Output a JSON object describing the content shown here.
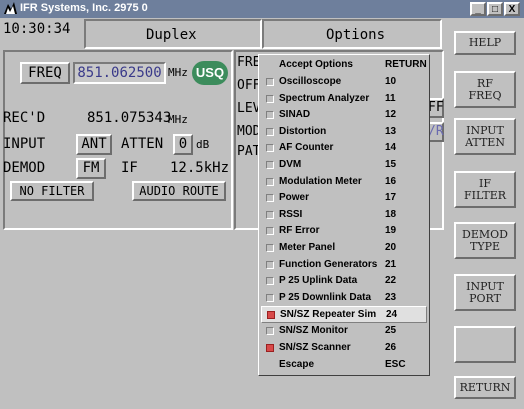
{
  "window": {
    "title": "IFR Systems, Inc. 2975 0",
    "minimize": "_",
    "maximize": "□",
    "close": "X"
  },
  "header": {
    "time": "10:30:34",
    "mode": "Duplex",
    "options": "Options"
  },
  "left": {
    "freq_label": "FREQ",
    "freq_value": "851.062500",
    "freq_unit": "MHz",
    "usq": "USQ",
    "rec_label": "REC'D",
    "rec_value": "851.075343",
    "rec_unit": "MHz",
    "input_label": "INPUT",
    "input_value": "ANT",
    "atten_label": "ATTEN",
    "atten_value": "0",
    "atten_unit": "dB",
    "demod_label": "DEMOD",
    "demod_value": "FM",
    "if_label": "IF",
    "if_value": "12.5kHz",
    "no_filter": "NO FILTER",
    "audio_route": "AUDIO ROUTE"
  },
  "middle": {
    "labels": [
      "FRE",
      "OFF",
      "LEV",
      "MOD",
      "PAT"
    ],
    "ff": "FF",
    "vr": "/R"
  },
  "menu": {
    "header_left": "Accept Options",
    "header_right": "RETURN",
    "items": [
      {
        "label": "Oscilloscope",
        "key": "10",
        "checked": false
      },
      {
        "label": "Spectrum Analyzer",
        "key": "11",
        "checked": false
      },
      {
        "label": "SINAD",
        "key": "12",
        "checked": false
      },
      {
        "label": "Distortion",
        "key": "13",
        "checked": false
      },
      {
        "label": "AF Counter",
        "key": "14",
        "checked": false
      },
      {
        "label": "DVM",
        "key": "15",
        "checked": false
      },
      {
        "label": "Modulation Meter",
        "key": "16",
        "checked": false
      },
      {
        "label": "Power",
        "key": "17",
        "checked": false
      },
      {
        "label": "RSSI",
        "key": "18",
        "checked": false
      },
      {
        "label": "RF Error",
        "key": "19",
        "checked": false
      },
      {
        "label": "Meter Panel",
        "key": "20",
        "checked": false
      },
      {
        "label": "Function Generators",
        "key": "21",
        "checked": false
      },
      {
        "label": "P 25 Uplink Data",
        "key": "22",
        "checked": false
      },
      {
        "label": "P 25 Downlink Data",
        "key": "23",
        "checked": false
      },
      {
        "label": "SN/SZ Repeater Sim",
        "key": "24",
        "checked": true,
        "highlight": true
      },
      {
        "label": "SN/SZ Monitor",
        "key": "25",
        "checked": false
      },
      {
        "label": "SN/SZ Scanner",
        "key": "26",
        "checked": true
      }
    ],
    "escape_label": "Escape",
    "escape_key": "ESC"
  },
  "side": {
    "help": "HELP",
    "rf1": "RF",
    "rf2": "FREQ",
    "ia1": "INPUT",
    "ia2": "ATTEN",
    "if1": "IF",
    "if2": "FILTER",
    "dt1": "DEMOD",
    "dt2": "TYPE",
    "ip1": "INPUT",
    "ip2": "PORT",
    "blank": "",
    "ret": "RETURN"
  },
  "colors": {
    "titlebar": "#6e7f9c",
    "usq": "#3c8c5c",
    "field_text": "#3a3a8a",
    "check_on": "#d84a4a"
  }
}
